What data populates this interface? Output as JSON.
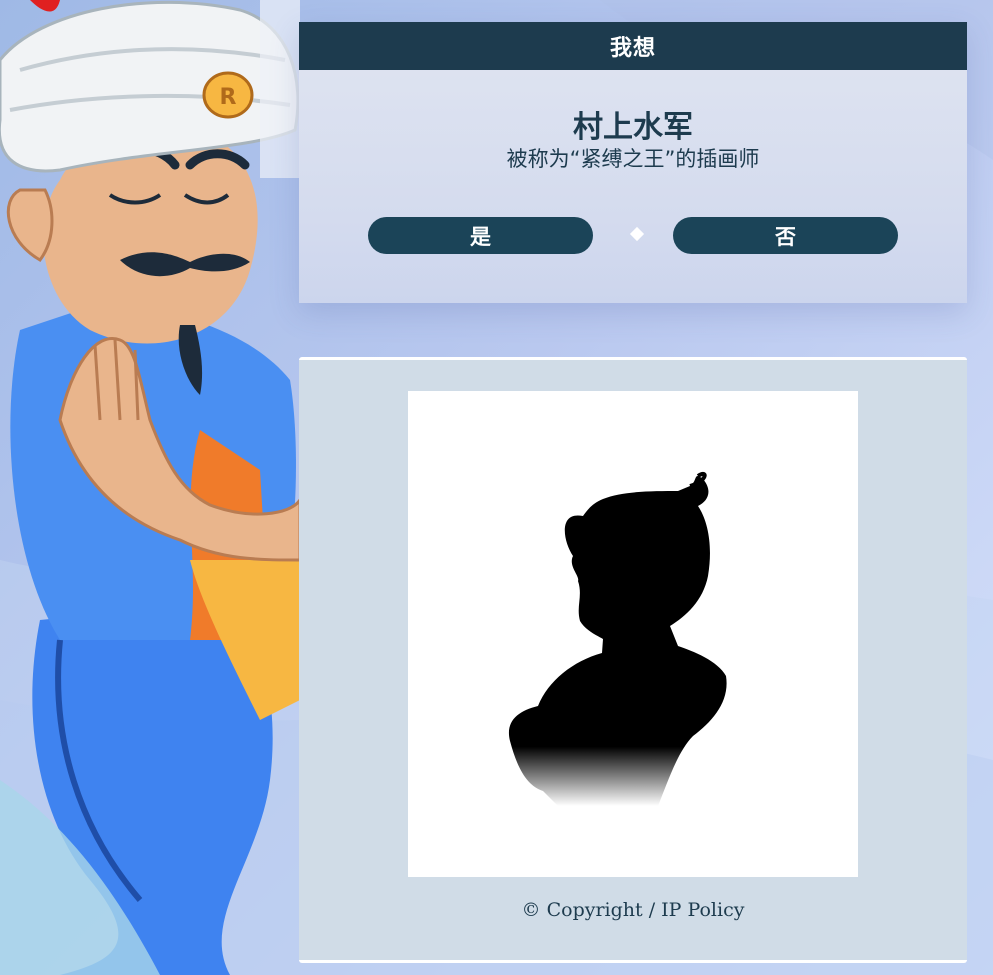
{
  "guess": {
    "header": "我想",
    "name": "村上水军",
    "description": "被称为“紧缚之王”的插画师"
  },
  "answers": {
    "yes": "是",
    "no": "否"
  },
  "footer": {
    "copyright": "© Copyright / IP Policy"
  },
  "colors": {
    "header_bg": "#1d3b4e",
    "button_bg": "#1b4458",
    "panel_bg": "#d0dce7",
    "text": "#1d3b4e"
  },
  "icons": {
    "separator": "diamond-icon",
    "character": "genie-mascot",
    "photo": "silhouette-placeholder"
  }
}
